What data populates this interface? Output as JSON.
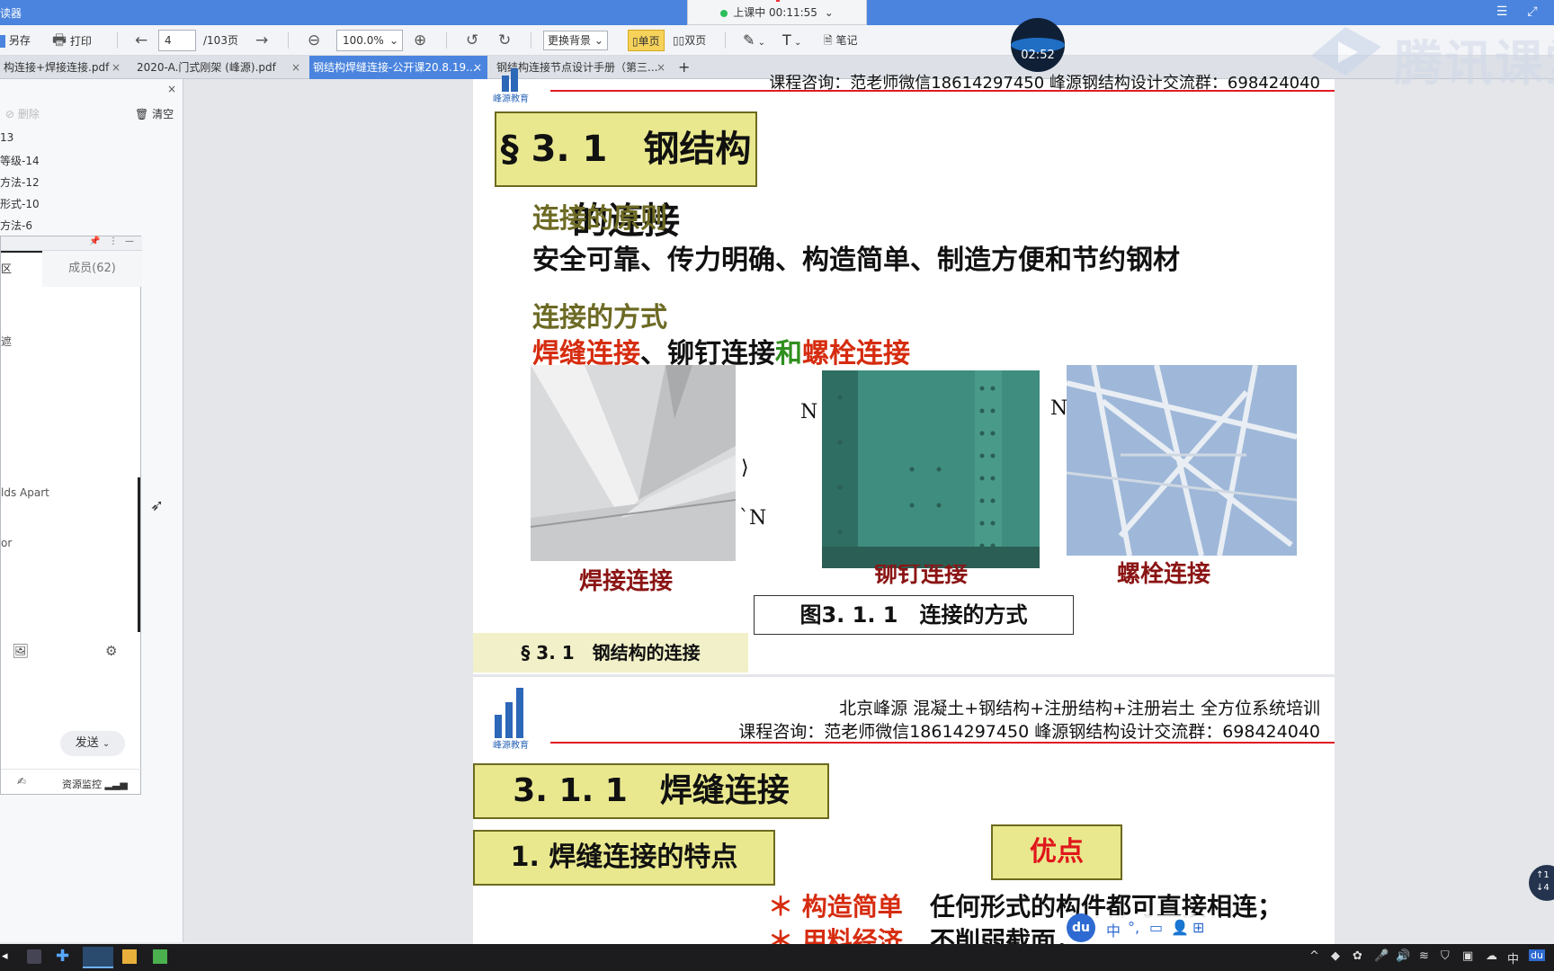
{
  "window": {
    "title": "读器"
  },
  "live": {
    "status": "上课中 00:11:55"
  },
  "timer": {
    "value": "02:52"
  },
  "watermark": {
    "text": "腾讯课堂"
  },
  "toolbar": {
    "save_as": "另存",
    "print": "打印",
    "page_current": "4",
    "page_total": "/103页",
    "zoom": "100.0%",
    "background": "更换背景",
    "single_page": "单页",
    "double_page": "双页",
    "notes": "笔记"
  },
  "tabs": [
    {
      "label": "构连接+焊接连接.pdf",
      "active": false
    },
    {
      "label": "2020-A.门式刚架 (峰源).pdf",
      "active": false
    },
    {
      "label": "钢结构焊缝连接-公开课20.8.19...",
      "active": true
    },
    {
      "label": "钢结构连接节点设计手册（第三...",
      "active": false
    }
  ],
  "left_panel": {
    "delete": "删除",
    "clear": "清空",
    "bookmarks": [
      "13",
      "等级-14",
      "方法-12",
      "形式-10",
      "方法-6"
    ]
  },
  "chat": {
    "tab_discussion": "区",
    "tab_members": "成员(62)",
    "line1": "遮",
    "line2": "lds Apart",
    "line3": "or",
    "send": "发送",
    "resource_monitor": "资源监控"
  },
  "slide1": {
    "header_consult": "课程咨询：范老师微信18614297450  峰源钢结构设计交流群：698424040",
    "logo_caption": "峰源教育",
    "title": "§ 3. 1　钢结构的连接",
    "principle_heading": "连接的原则",
    "principle_text": "安全可靠、传力明确、构造简单、制造方便和节约钢材",
    "methods_heading": "连接的方式",
    "method_weld": "焊缝连接",
    "method_sep": "、铆钉连接",
    "method_and": "和",
    "method_bolt": "螺栓连接",
    "caption_weld": "焊接连接",
    "caption_rivet": "铆钉连接",
    "caption_bolt": "螺栓连接",
    "n_label": "N",
    "n_label2": "`N",
    "n_label3": "N",
    "figure_caption": "图3. 1. 1　连接的方式",
    "footer_band": "§ 3. 1　钢结构的连接"
  },
  "slide2": {
    "header_company": "北京峰源 混凝土+钢结构+注册结构+注册岩土 全方位系统培训",
    "header_consult": "课程咨询：范老师微信18614297450  峰源钢结构设计交流群：698424040",
    "logo_caption": "峰源教育",
    "section_title": "3. 1. 1　焊缝连接",
    "subsection_title": "1.  焊缝连接的特点",
    "advantages": "优点",
    "item1_key": "＊ 构造简单",
    "item1_text": "任何形式的构件都可直接相连；",
    "item2_key": "＊ 用料经济",
    "item2_text": "不削弱截面，"
  },
  "ime": {
    "lang": "中",
    "logo": "du"
  },
  "taskbar": {
    "clock_lang": "中"
  },
  "colors": {
    "accent": "#4a84de",
    "slide_title_bg": "#e9e88e",
    "red": "#e01b24",
    "weld_red": "#d62c0f",
    "and_green": "#2f8f1f"
  }
}
